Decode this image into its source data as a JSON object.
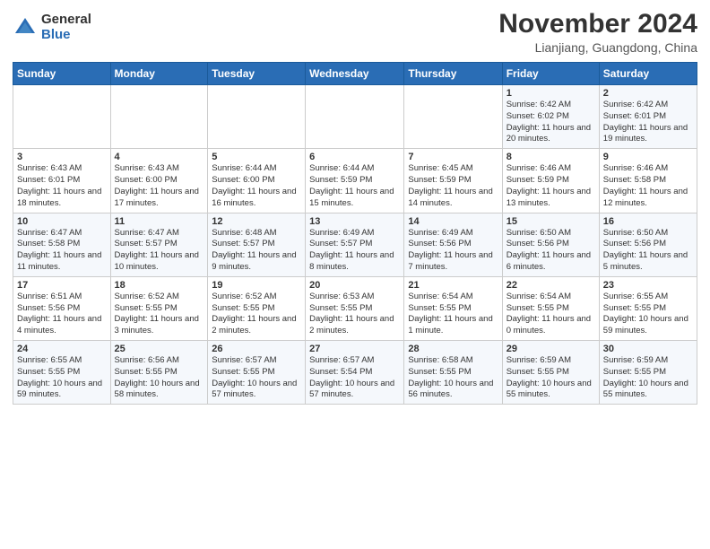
{
  "header": {
    "logo_general": "General",
    "logo_blue": "Blue",
    "month_title": "November 2024",
    "location": "Lianjiang, Guangdong, China"
  },
  "weekdays": [
    "Sunday",
    "Monday",
    "Tuesday",
    "Wednesday",
    "Thursday",
    "Friday",
    "Saturday"
  ],
  "weeks": [
    [
      {
        "day": "",
        "info": ""
      },
      {
        "day": "",
        "info": ""
      },
      {
        "day": "",
        "info": ""
      },
      {
        "day": "",
        "info": ""
      },
      {
        "day": "",
        "info": ""
      },
      {
        "day": "1",
        "info": "Sunrise: 6:42 AM\nSunset: 6:02 PM\nDaylight: 11 hours\nand 20 minutes."
      },
      {
        "day": "2",
        "info": "Sunrise: 6:42 AM\nSunset: 6:01 PM\nDaylight: 11 hours\nand 19 minutes."
      }
    ],
    [
      {
        "day": "3",
        "info": "Sunrise: 6:43 AM\nSunset: 6:01 PM\nDaylight: 11 hours\nand 18 minutes."
      },
      {
        "day": "4",
        "info": "Sunrise: 6:43 AM\nSunset: 6:00 PM\nDaylight: 11 hours\nand 17 minutes."
      },
      {
        "day": "5",
        "info": "Sunrise: 6:44 AM\nSunset: 6:00 PM\nDaylight: 11 hours\nand 16 minutes."
      },
      {
        "day": "6",
        "info": "Sunrise: 6:44 AM\nSunset: 5:59 PM\nDaylight: 11 hours\nand 15 minutes."
      },
      {
        "day": "7",
        "info": "Sunrise: 6:45 AM\nSunset: 5:59 PM\nDaylight: 11 hours\nand 14 minutes."
      },
      {
        "day": "8",
        "info": "Sunrise: 6:46 AM\nSunset: 5:59 PM\nDaylight: 11 hours\nand 13 minutes."
      },
      {
        "day": "9",
        "info": "Sunrise: 6:46 AM\nSunset: 5:58 PM\nDaylight: 11 hours\nand 12 minutes."
      }
    ],
    [
      {
        "day": "10",
        "info": "Sunrise: 6:47 AM\nSunset: 5:58 PM\nDaylight: 11 hours\nand 11 minutes."
      },
      {
        "day": "11",
        "info": "Sunrise: 6:47 AM\nSunset: 5:57 PM\nDaylight: 11 hours\nand 10 minutes."
      },
      {
        "day": "12",
        "info": "Sunrise: 6:48 AM\nSunset: 5:57 PM\nDaylight: 11 hours\nand 9 minutes."
      },
      {
        "day": "13",
        "info": "Sunrise: 6:49 AM\nSunset: 5:57 PM\nDaylight: 11 hours\nand 8 minutes."
      },
      {
        "day": "14",
        "info": "Sunrise: 6:49 AM\nSunset: 5:56 PM\nDaylight: 11 hours\nand 7 minutes."
      },
      {
        "day": "15",
        "info": "Sunrise: 6:50 AM\nSunset: 5:56 PM\nDaylight: 11 hours\nand 6 minutes."
      },
      {
        "day": "16",
        "info": "Sunrise: 6:50 AM\nSunset: 5:56 PM\nDaylight: 11 hours\nand 5 minutes."
      }
    ],
    [
      {
        "day": "17",
        "info": "Sunrise: 6:51 AM\nSunset: 5:56 PM\nDaylight: 11 hours\nand 4 minutes."
      },
      {
        "day": "18",
        "info": "Sunrise: 6:52 AM\nSunset: 5:55 PM\nDaylight: 11 hours\nand 3 minutes."
      },
      {
        "day": "19",
        "info": "Sunrise: 6:52 AM\nSunset: 5:55 PM\nDaylight: 11 hours\nand 2 minutes."
      },
      {
        "day": "20",
        "info": "Sunrise: 6:53 AM\nSunset: 5:55 PM\nDaylight: 11 hours\nand 2 minutes."
      },
      {
        "day": "21",
        "info": "Sunrise: 6:54 AM\nSunset: 5:55 PM\nDaylight: 11 hours\nand 1 minute."
      },
      {
        "day": "22",
        "info": "Sunrise: 6:54 AM\nSunset: 5:55 PM\nDaylight: 11 hours\nand 0 minutes."
      },
      {
        "day": "23",
        "info": "Sunrise: 6:55 AM\nSunset: 5:55 PM\nDaylight: 10 hours\nand 59 minutes."
      }
    ],
    [
      {
        "day": "24",
        "info": "Sunrise: 6:55 AM\nSunset: 5:55 PM\nDaylight: 10 hours\nand 59 minutes."
      },
      {
        "day": "25",
        "info": "Sunrise: 6:56 AM\nSunset: 5:55 PM\nDaylight: 10 hours\nand 58 minutes."
      },
      {
        "day": "26",
        "info": "Sunrise: 6:57 AM\nSunset: 5:55 PM\nDaylight: 10 hours\nand 57 minutes."
      },
      {
        "day": "27",
        "info": "Sunrise: 6:57 AM\nSunset: 5:54 PM\nDaylight: 10 hours\nand 57 minutes."
      },
      {
        "day": "28",
        "info": "Sunrise: 6:58 AM\nSunset: 5:55 PM\nDaylight: 10 hours\nand 56 minutes."
      },
      {
        "day": "29",
        "info": "Sunrise: 6:59 AM\nSunset: 5:55 PM\nDaylight: 10 hours\nand 55 minutes."
      },
      {
        "day": "30",
        "info": "Sunrise: 6:59 AM\nSunset: 5:55 PM\nDaylight: 10 hours\nand 55 minutes."
      }
    ]
  ]
}
